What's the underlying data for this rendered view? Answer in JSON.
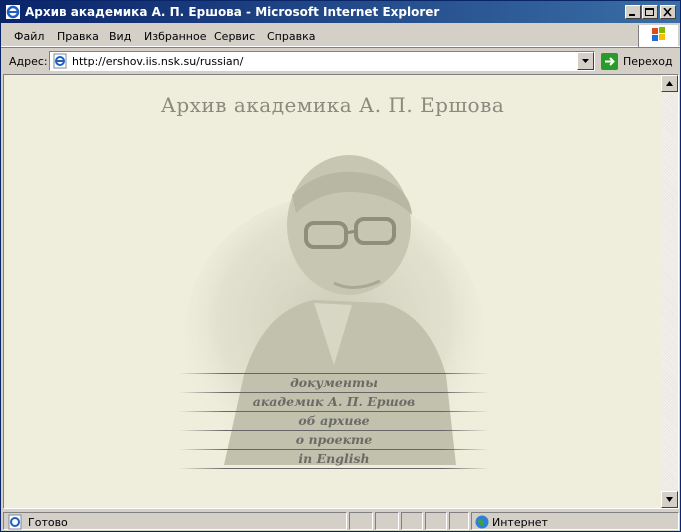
{
  "window": {
    "title": "Архив академика А. П. Ершова - Microsoft Internet Explorer"
  },
  "menubar": {
    "items": [
      "Файл",
      "Правка",
      "Вид",
      "Избранное",
      "Сервис",
      "Справка"
    ]
  },
  "addressbar": {
    "label": "Адрес:",
    "url": "http://ershov.iis.nsk.su/russian/",
    "go_label": "Переход"
  },
  "page": {
    "heading": "Архив академика А. П. Ершова",
    "nav": [
      "документы",
      "академик А. П. Ершов",
      "об архиве",
      "о проекте",
      "in English"
    ]
  },
  "statusbar": {
    "status": "Готово",
    "zone": "Интернет"
  },
  "colors": {
    "title_bar": "#0a246a",
    "page_background": "#efeddc",
    "nav_text": "#6b6b66"
  }
}
